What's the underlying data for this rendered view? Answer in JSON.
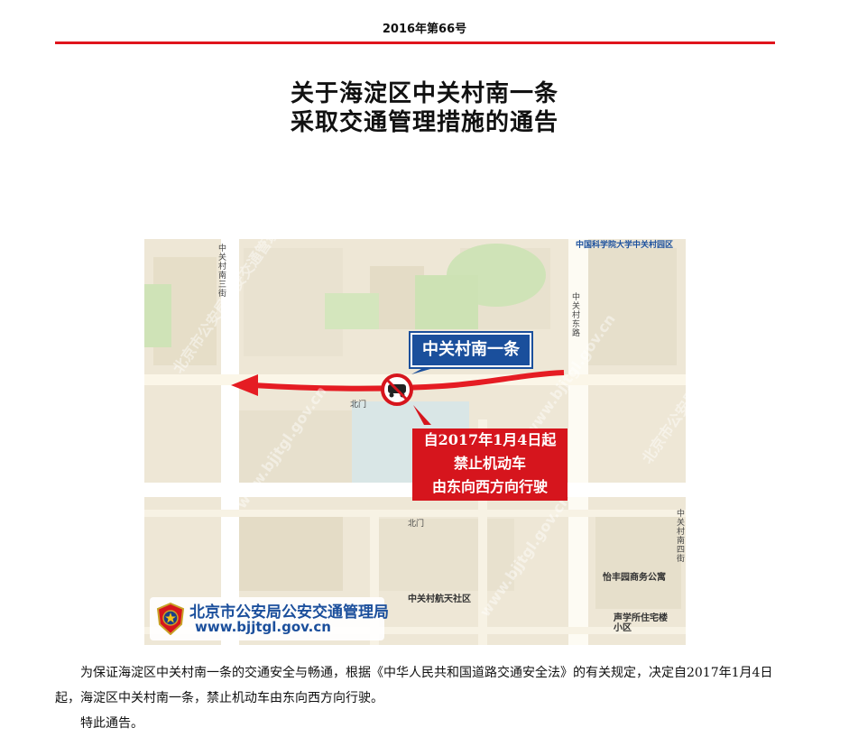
{
  "header": {
    "issue": "2016年第66号"
  },
  "title": {
    "line1": "关于海淀区中关村南一条",
    "line2": "采取交通管理措施的通告"
  },
  "map": {
    "road_label": "中关村南一条",
    "notice_line1": "自2017年1月4日起",
    "notice_line2": "禁止机动车",
    "notice_line3": "由东向西方向行驶",
    "logo_name": "北京市公安局公安交通管理局",
    "logo_url": "www.bjjtgl.gov.cn",
    "street_labels": [
      "中关村南三街",
      "中关村东路",
      "中关村南四街",
      "中国科学院大学中关村园区",
      "怡丰园商务公寓",
      "中关村航天社区",
      "声学所住宅楼小区",
      "北门",
      "北门"
    ]
  },
  "body": {
    "paragraph1": "为保证海淀区中关村南一条的交通安全与畅通，根据《中华人民共和国道路交通安全法》的有关规定，决定自2017年1月4日起，海淀区中关村南一条，禁止机动车由东向西方向行驶。",
    "paragraph2": "特此通告。"
  },
  "colors": {
    "accent_red": "#e0141c",
    "label_blue": "#1a4f9c",
    "arrow_red": "#e51c23"
  }
}
